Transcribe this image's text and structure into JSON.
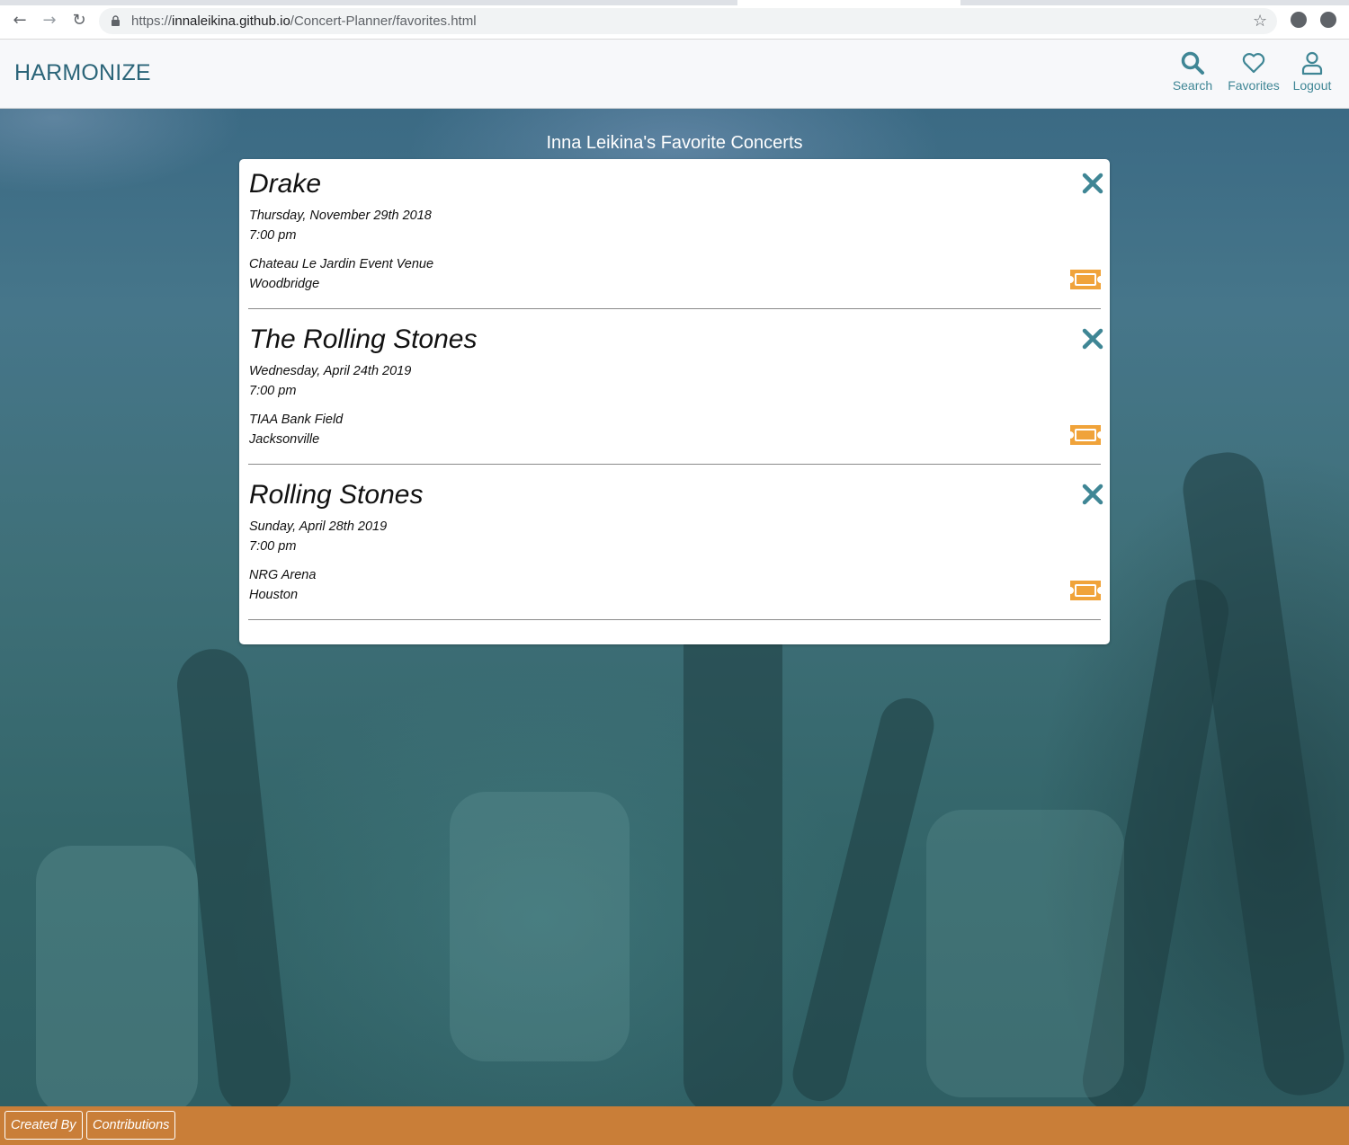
{
  "browser": {
    "url_scheme": "https://",
    "url_host": "innaleikina.github.io",
    "url_path": "/Concert-Planner/favorites.html"
  },
  "header": {
    "brand": "HARMONIZE",
    "nav": [
      {
        "label": "Search",
        "icon": "search-icon"
      },
      {
        "label": "Favorites",
        "icon": "heart-icon"
      },
      {
        "label": "Logout",
        "icon": "user-icon"
      }
    ]
  },
  "page_title": "Inna Leikina's Favorite Concerts",
  "concerts": [
    {
      "name": "Drake",
      "date": "Thursday, November 29th 2018",
      "time": "7:00 pm",
      "venue": "Chateau Le Jardin Event Venue",
      "city": "Woodbridge"
    },
    {
      "name": "The Rolling Stones",
      "date": "Wednesday, April 24th 2019",
      "time": "7:00 pm",
      "venue": "TIAA Bank Field",
      "city": "Jacksonville"
    },
    {
      "name": "Rolling Stones",
      "date": "Sunday, April 28th 2019",
      "time": "7:00 pm",
      "venue": "NRG Arena",
      "city": "Houston"
    }
  ],
  "footer": {
    "created_by": "Created By",
    "contributions": "Contributions"
  },
  "colors": {
    "brand": "#2b6579",
    "accent_teal": "#3f8695",
    "ticket_orange": "#f0a33a",
    "footer_orange": "#c97e38"
  }
}
